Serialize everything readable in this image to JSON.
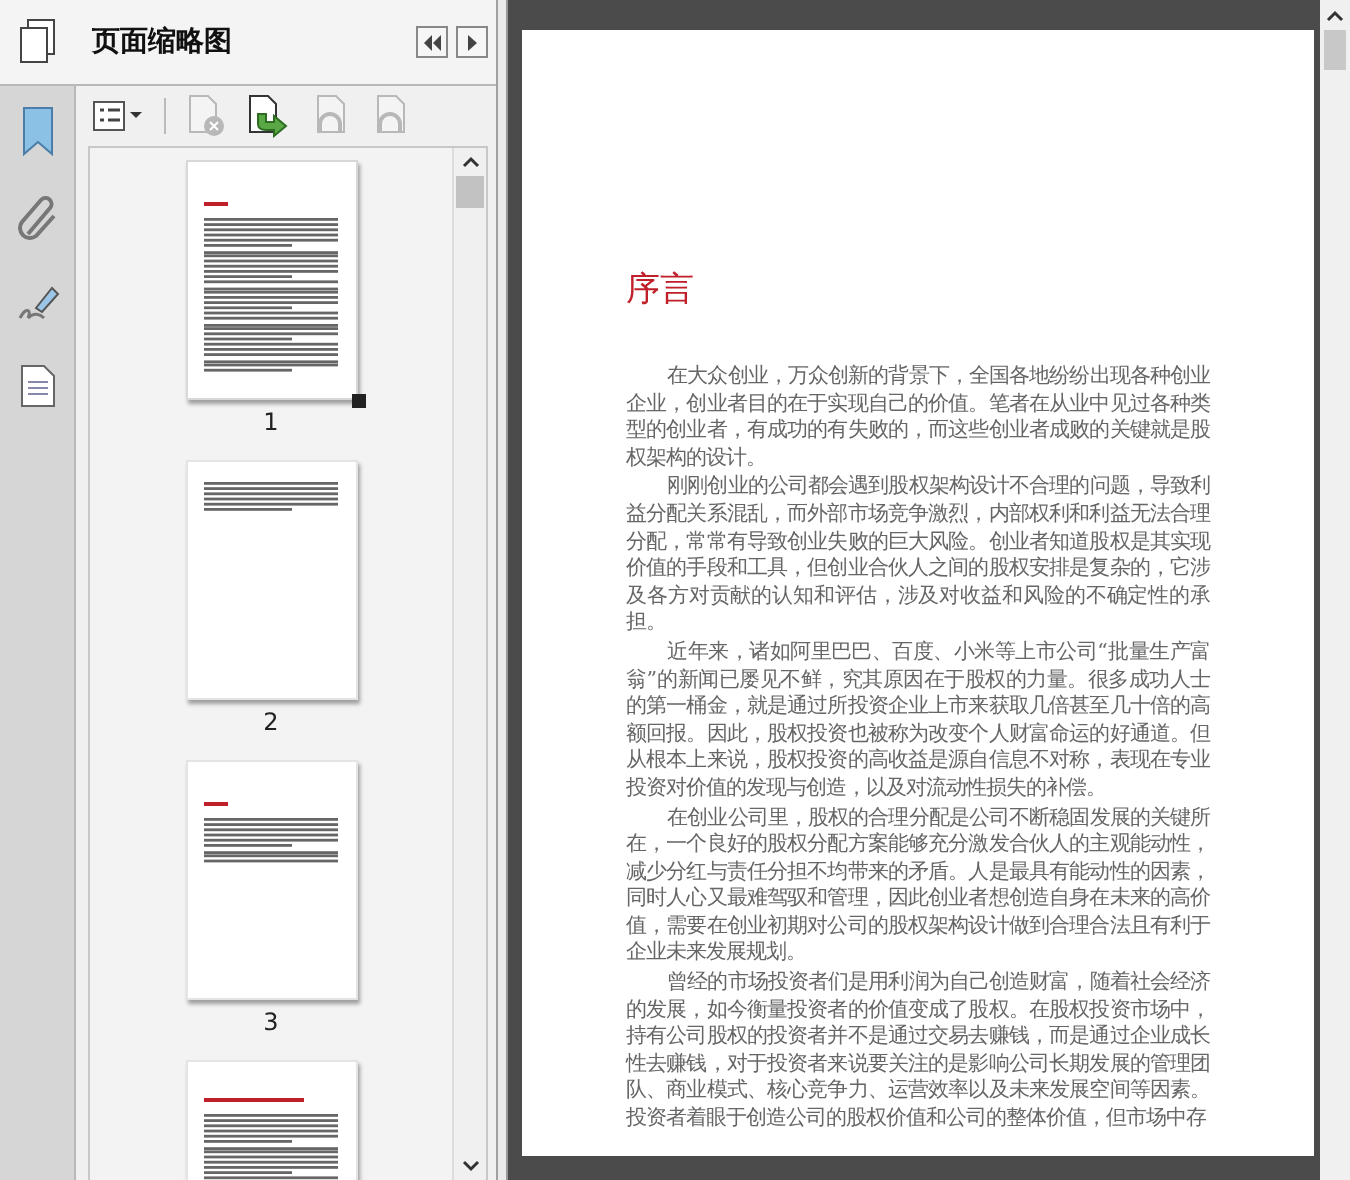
{
  "panel": {
    "title": "页面缩略图"
  },
  "thumbnails": [
    {
      "label": "1",
      "selected": true
    },
    {
      "label": "2",
      "selected": false
    },
    {
      "label": "3",
      "selected": false
    },
    {
      "selected": false
    }
  ],
  "document": {
    "heading": "序言",
    "paragraphs": [
      "在大众创业，万众创新的背景下，全国各地纷纷出现各种创业企业，创业者目的在于实现自己的价值。笔者在从业中见过各种类型的创业者，有成功的有失败的，而这些创业者成败的关键就是股权架构的设计。",
      "刚刚创业的公司都会遇到股权架构设计不合理的问题，导致利益分配关系混乱，而外部市场竞争激烈，内部权利和利益无法合理分配，常常有导致创业失败的巨大风险。创业者知道股权是其实现价值的手段和工具，但创业合伙人之间的股权安排是复杂的，它涉及各方对贡献的认知和评估，涉及对收益和风险的不确定性的承担。",
      "近年来，诸如阿里巴巴、百度、小米等上市公司“批量生产富翁”的新闻已屡见不鲜，究其原因在于股权的力量。很多成功人士的第一桶金，就是通过所投资企业上市来获取几倍甚至几十倍的高额回报。因此，股权投资也被称为改变个人财富命运的好通道。但从根本上来说，股权投资的高收益是源自信息不对称，表现在专业投资对价值的发现与创造，以及对流动性损失的补偿。",
      "在创业公司里，股权的合理分配是公司不断稳固发展的关键所在，一个良好的股权分配方案能够充分激发合伙人的主观能动性，减少分红与责任分担不均带来的矛盾。人是最具有能动性的因素，同时人心又最难驾驭和管理，因此创业者想创造自身在未来的高价值，需要在创业初期对公司的股权架构设计做到合理合法且有利于企业未来发展规划。",
      "曾经的市场投资者们是用利润为自己创造财富，随着社会经济的发展，如今衡量投资者的价值变成了股权。在股权投资市场中，持有公司股权的投资者并不是通过交易去赚钱，而是通过企业成长性去赚钱，对于投资者来说要关注的是影响公司长期发展的管理团队、商业模式、核心竞争力、运营效率以及未来发展空间等因素。投资者着眼于创造公司的股权价值和公司的整体价值，但市场中存"
    ]
  }
}
